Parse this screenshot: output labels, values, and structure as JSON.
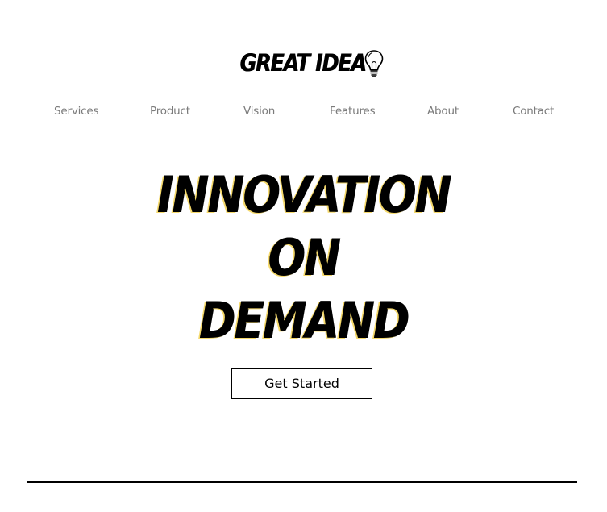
{
  "brand": {
    "name": "GREAT IDEA",
    "logo_icon": "lightbulb-icon"
  },
  "nav": {
    "items": [
      {
        "label": "Services"
      },
      {
        "label": "Product"
      },
      {
        "label": "Vision"
      },
      {
        "label": "Features"
      },
      {
        "label": "About"
      },
      {
        "label": "Contact"
      }
    ]
  },
  "hero": {
    "lines": [
      "INNOVATION",
      "ON",
      "DEMAND"
    ],
    "cta_label": "Get Started"
  },
  "colors": {
    "text": "#000000",
    "nav_text": "#7b7b7b",
    "background": "#ffffff",
    "heading_shadow": "#f5d96b"
  }
}
